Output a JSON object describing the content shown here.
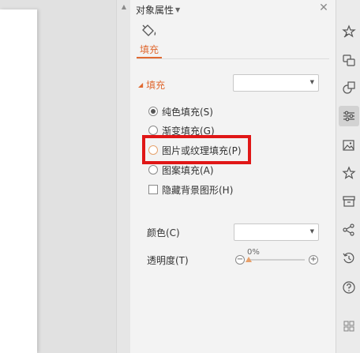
{
  "panel": {
    "title": "对象属性",
    "tab_label": "填充",
    "fill_section_title": "填充",
    "fill_type_value": "",
    "options": [
      {
        "label": "纯色填充(S)",
        "type": "radio",
        "checked": true
      },
      {
        "label": "渐变填充(G)",
        "type": "radio",
        "checked": false
      },
      {
        "label": "图片或纹理填充(P)",
        "type": "radio",
        "checked": false,
        "highlighted": true
      },
      {
        "label": "图案填充(A)",
        "type": "radio",
        "checked": false
      },
      {
        "label": "隐藏背景图形(H)",
        "type": "checkbox",
        "checked": false
      }
    ],
    "color_label": "颜色(C)",
    "color_value": "",
    "opacity_label": "透明度(T)",
    "opacity_value": "0%",
    "opacity_fraction": 0.0
  },
  "right_toolbar": [
    {
      "icon": "magic-star-icon",
      "active": false
    },
    {
      "icon": "switch-icon",
      "active": false
    },
    {
      "icon": "shapes-icon",
      "active": false
    },
    {
      "icon": "adjust-sliders-icon",
      "active": true
    },
    {
      "icon": "image-gallery-icon",
      "active": false
    },
    {
      "icon": "star-icon",
      "active": false
    },
    {
      "icon": "archive-box-icon",
      "active": false
    },
    {
      "icon": "share-icon",
      "active": false
    },
    {
      "icon": "history-icon",
      "active": false
    },
    {
      "icon": "help-icon",
      "active": false
    },
    {
      "icon": "grid-apps-icon",
      "active": false
    }
  ],
  "colors": {
    "accent": "#e06a32",
    "highlight": "#e01717"
  }
}
